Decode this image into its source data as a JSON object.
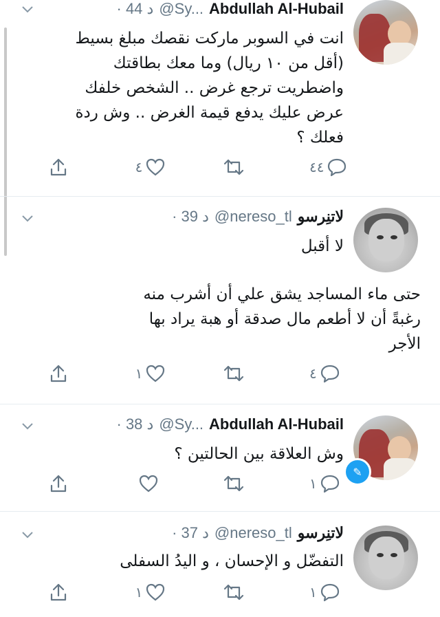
{
  "tweets": [
    {
      "name": "Abdullah Al-Hubail",
      "handle": "@Sy...",
      "time": "· 44 د",
      "text": "انت في السوبر ماركت نقصك مبلغ بسيط\n(أقل من ١٠ ريال) وما معك بطاقتك\nواضطريت ترجع غرض .. الشخص خلفك\nعرض عليك يدفع قيمة الغرض .. وش ردة\nفعلك ؟",
      "reply_count": "٤٤",
      "retweet_count": "",
      "like_count": "٤"
    },
    {
      "name": "لاتنِرسو",
      "handle": "@nereso_tl",
      "time": "· 39 د",
      "text": "لا أقبل",
      "text2": "حتى ماء المساجد يشق علي أن أشرب منه\nرغبةً أن لا أطعم مال صدقة أو هبة يراد بها\nالأجر",
      "reply_count": "٤",
      "retweet_count": "",
      "like_count": "١"
    },
    {
      "name": "Abdullah Al-Hubail",
      "handle": "@Sy...",
      "time": "· 38 د",
      "text": "وش العلاقة بين الحالتين ؟",
      "reply_count": "١",
      "retweet_count": "",
      "like_count": ""
    },
    {
      "name": "لاتنِرسو",
      "handle": "@nereso_tl",
      "time": "· 37 د",
      "text": "التفضّل و الإحسان ، و اليدُ السفلى",
      "reply_count": "١",
      "retweet_count": "",
      "like_count": "١"
    }
  ],
  "colors": {
    "icon": "#657786",
    "accent": "#1da1f2",
    "divider": "#e6ecf0"
  },
  "icons": [
    "reply-icon",
    "retweet-icon",
    "like-icon",
    "share-icon",
    "chevron-down-icon",
    "edit-icon"
  ]
}
